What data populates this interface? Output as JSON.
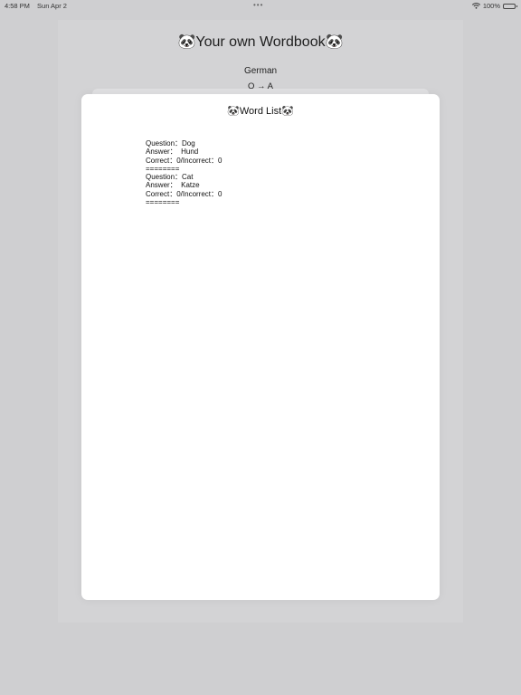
{
  "status_bar": {
    "time": "4:58 PM",
    "date": "Sun Apr 2",
    "multitask_dots": "•••",
    "battery": "100%",
    "wifi_icon": "wifi-icon",
    "battery_icon": "battery-icon"
  },
  "app": {
    "title": "🐼Your own Wordbook🐼",
    "language": "German",
    "direction": "Q → A"
  },
  "modal": {
    "title": "🐼Word List🐼",
    "entries": [
      {
        "question": "Question：Dog",
        "answer": "Answer：  Hund",
        "score": "Correct：0/Incorrect：0",
        "separator": "========"
      },
      {
        "question": "Question：Cat",
        "answer": "Answer：  Katze",
        "score": "Correct：0/Incorrect：0",
        "separator": "========"
      }
    ]
  }
}
